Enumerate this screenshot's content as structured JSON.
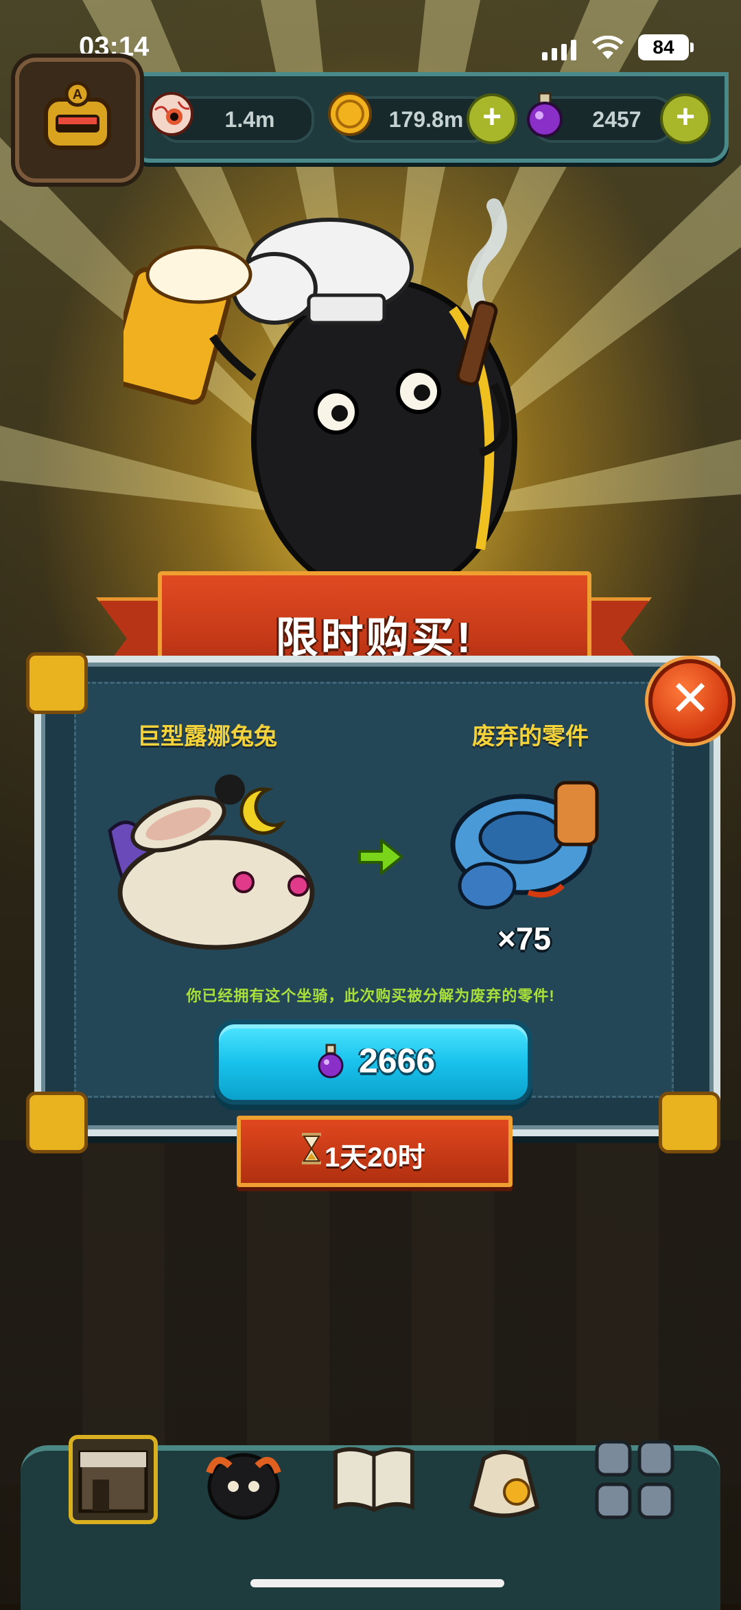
{
  "status_bar": {
    "time": "03:14",
    "battery": "84"
  },
  "hud": {
    "eye_value": "1.4m",
    "coin_value": "179.8m",
    "potion_value": "2457",
    "plus_label": "+"
  },
  "offer": {
    "title": "限时购买!",
    "left_item_name": "巨型露娜兔兔",
    "right_item_name": "废弃的零件",
    "quantity": "×75",
    "notice": "你已经拥有这个坐骑，此次购买被分解为废弃的零件!",
    "price": "2666",
    "timer": "1天20时",
    "close_label": "✕"
  },
  "icons": [
    "avatar-icon",
    "eyeball-icon",
    "coin-icon",
    "potion-icon",
    "plus-icon",
    "rabbit-icon",
    "arrow-right-icon",
    "scrap-parts-icon",
    "hourglass-icon",
    "close-icon",
    "shop-icon",
    "monster-icon",
    "book-icon",
    "bag-icon",
    "grid-icon"
  ]
}
